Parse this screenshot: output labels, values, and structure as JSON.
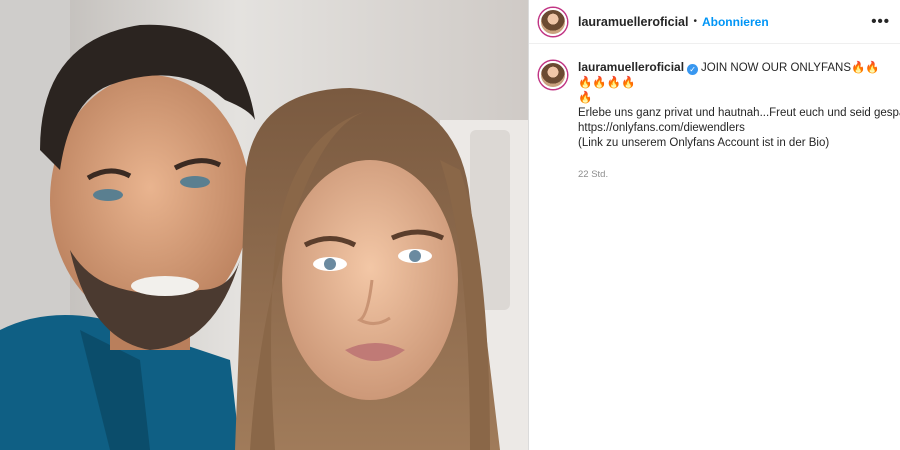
{
  "post": {
    "media": {
      "alt": "Selfie"
    },
    "header": {
      "username": "lauramuelleroficial",
      "separator": "•",
      "follow_label": "Abonnieren",
      "more_label": "•••"
    },
    "caption": {
      "username": "lauramuelleroficial",
      "verified_mark": "✓",
      "headline": "JOIN NOW OUR ONLYFANS🔥🔥🔥🔥🔥🔥",
      "headline_tail": "🔥",
      "line1": "Erlebe uns ganz privat und hautnah...Freut euch und seid gespannt!",
      "line2": "https://onlyfans.com/diewendlers",
      "line3": "(Link zu unserem Onlyfans Account ist in der Bio)",
      "timestamp": "22 Std."
    },
    "colors": {
      "accent": "#0095f6",
      "verified": "#3897f0",
      "muted": "#8e8e8e"
    }
  }
}
